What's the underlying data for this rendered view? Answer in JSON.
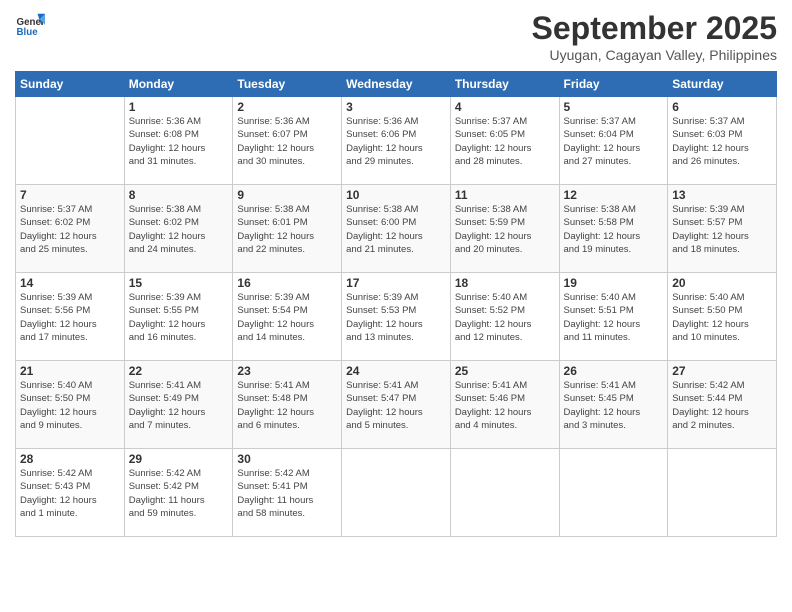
{
  "header": {
    "logo_general": "General",
    "logo_blue": "Blue",
    "month_title": "September 2025",
    "location": "Uyugan, Cagayan Valley, Philippines"
  },
  "days_of_week": [
    "Sunday",
    "Monday",
    "Tuesday",
    "Wednesday",
    "Thursday",
    "Friday",
    "Saturday"
  ],
  "weeks": [
    [
      {
        "day": "",
        "info": ""
      },
      {
        "day": "1",
        "info": "Sunrise: 5:36 AM\nSunset: 6:08 PM\nDaylight: 12 hours\nand 31 minutes."
      },
      {
        "day": "2",
        "info": "Sunrise: 5:36 AM\nSunset: 6:07 PM\nDaylight: 12 hours\nand 30 minutes."
      },
      {
        "day": "3",
        "info": "Sunrise: 5:36 AM\nSunset: 6:06 PM\nDaylight: 12 hours\nand 29 minutes."
      },
      {
        "day": "4",
        "info": "Sunrise: 5:37 AM\nSunset: 6:05 PM\nDaylight: 12 hours\nand 28 minutes."
      },
      {
        "day": "5",
        "info": "Sunrise: 5:37 AM\nSunset: 6:04 PM\nDaylight: 12 hours\nand 27 minutes."
      },
      {
        "day": "6",
        "info": "Sunrise: 5:37 AM\nSunset: 6:03 PM\nDaylight: 12 hours\nand 26 minutes."
      }
    ],
    [
      {
        "day": "7",
        "info": "Sunrise: 5:37 AM\nSunset: 6:02 PM\nDaylight: 12 hours\nand 25 minutes."
      },
      {
        "day": "8",
        "info": "Sunrise: 5:38 AM\nSunset: 6:02 PM\nDaylight: 12 hours\nand 24 minutes."
      },
      {
        "day": "9",
        "info": "Sunrise: 5:38 AM\nSunset: 6:01 PM\nDaylight: 12 hours\nand 22 minutes."
      },
      {
        "day": "10",
        "info": "Sunrise: 5:38 AM\nSunset: 6:00 PM\nDaylight: 12 hours\nand 21 minutes."
      },
      {
        "day": "11",
        "info": "Sunrise: 5:38 AM\nSunset: 5:59 PM\nDaylight: 12 hours\nand 20 minutes."
      },
      {
        "day": "12",
        "info": "Sunrise: 5:38 AM\nSunset: 5:58 PM\nDaylight: 12 hours\nand 19 minutes."
      },
      {
        "day": "13",
        "info": "Sunrise: 5:39 AM\nSunset: 5:57 PM\nDaylight: 12 hours\nand 18 minutes."
      }
    ],
    [
      {
        "day": "14",
        "info": "Sunrise: 5:39 AM\nSunset: 5:56 PM\nDaylight: 12 hours\nand 17 minutes."
      },
      {
        "day": "15",
        "info": "Sunrise: 5:39 AM\nSunset: 5:55 PM\nDaylight: 12 hours\nand 16 minutes."
      },
      {
        "day": "16",
        "info": "Sunrise: 5:39 AM\nSunset: 5:54 PM\nDaylight: 12 hours\nand 14 minutes."
      },
      {
        "day": "17",
        "info": "Sunrise: 5:39 AM\nSunset: 5:53 PM\nDaylight: 12 hours\nand 13 minutes."
      },
      {
        "day": "18",
        "info": "Sunrise: 5:40 AM\nSunset: 5:52 PM\nDaylight: 12 hours\nand 12 minutes."
      },
      {
        "day": "19",
        "info": "Sunrise: 5:40 AM\nSunset: 5:51 PM\nDaylight: 12 hours\nand 11 minutes."
      },
      {
        "day": "20",
        "info": "Sunrise: 5:40 AM\nSunset: 5:50 PM\nDaylight: 12 hours\nand 10 minutes."
      }
    ],
    [
      {
        "day": "21",
        "info": "Sunrise: 5:40 AM\nSunset: 5:50 PM\nDaylight: 12 hours\nand 9 minutes."
      },
      {
        "day": "22",
        "info": "Sunrise: 5:41 AM\nSunset: 5:49 PM\nDaylight: 12 hours\nand 7 minutes."
      },
      {
        "day": "23",
        "info": "Sunrise: 5:41 AM\nSunset: 5:48 PM\nDaylight: 12 hours\nand 6 minutes."
      },
      {
        "day": "24",
        "info": "Sunrise: 5:41 AM\nSunset: 5:47 PM\nDaylight: 12 hours\nand 5 minutes."
      },
      {
        "day": "25",
        "info": "Sunrise: 5:41 AM\nSunset: 5:46 PM\nDaylight: 12 hours\nand 4 minutes."
      },
      {
        "day": "26",
        "info": "Sunrise: 5:41 AM\nSunset: 5:45 PM\nDaylight: 12 hours\nand 3 minutes."
      },
      {
        "day": "27",
        "info": "Sunrise: 5:42 AM\nSunset: 5:44 PM\nDaylight: 12 hours\nand 2 minutes."
      }
    ],
    [
      {
        "day": "28",
        "info": "Sunrise: 5:42 AM\nSunset: 5:43 PM\nDaylight: 12 hours\nand 1 minute."
      },
      {
        "day": "29",
        "info": "Sunrise: 5:42 AM\nSunset: 5:42 PM\nDaylight: 11 hours\nand 59 minutes."
      },
      {
        "day": "30",
        "info": "Sunrise: 5:42 AM\nSunset: 5:41 PM\nDaylight: 11 hours\nand 58 minutes."
      },
      {
        "day": "",
        "info": ""
      },
      {
        "day": "",
        "info": ""
      },
      {
        "day": "",
        "info": ""
      },
      {
        "day": "",
        "info": ""
      }
    ]
  ]
}
